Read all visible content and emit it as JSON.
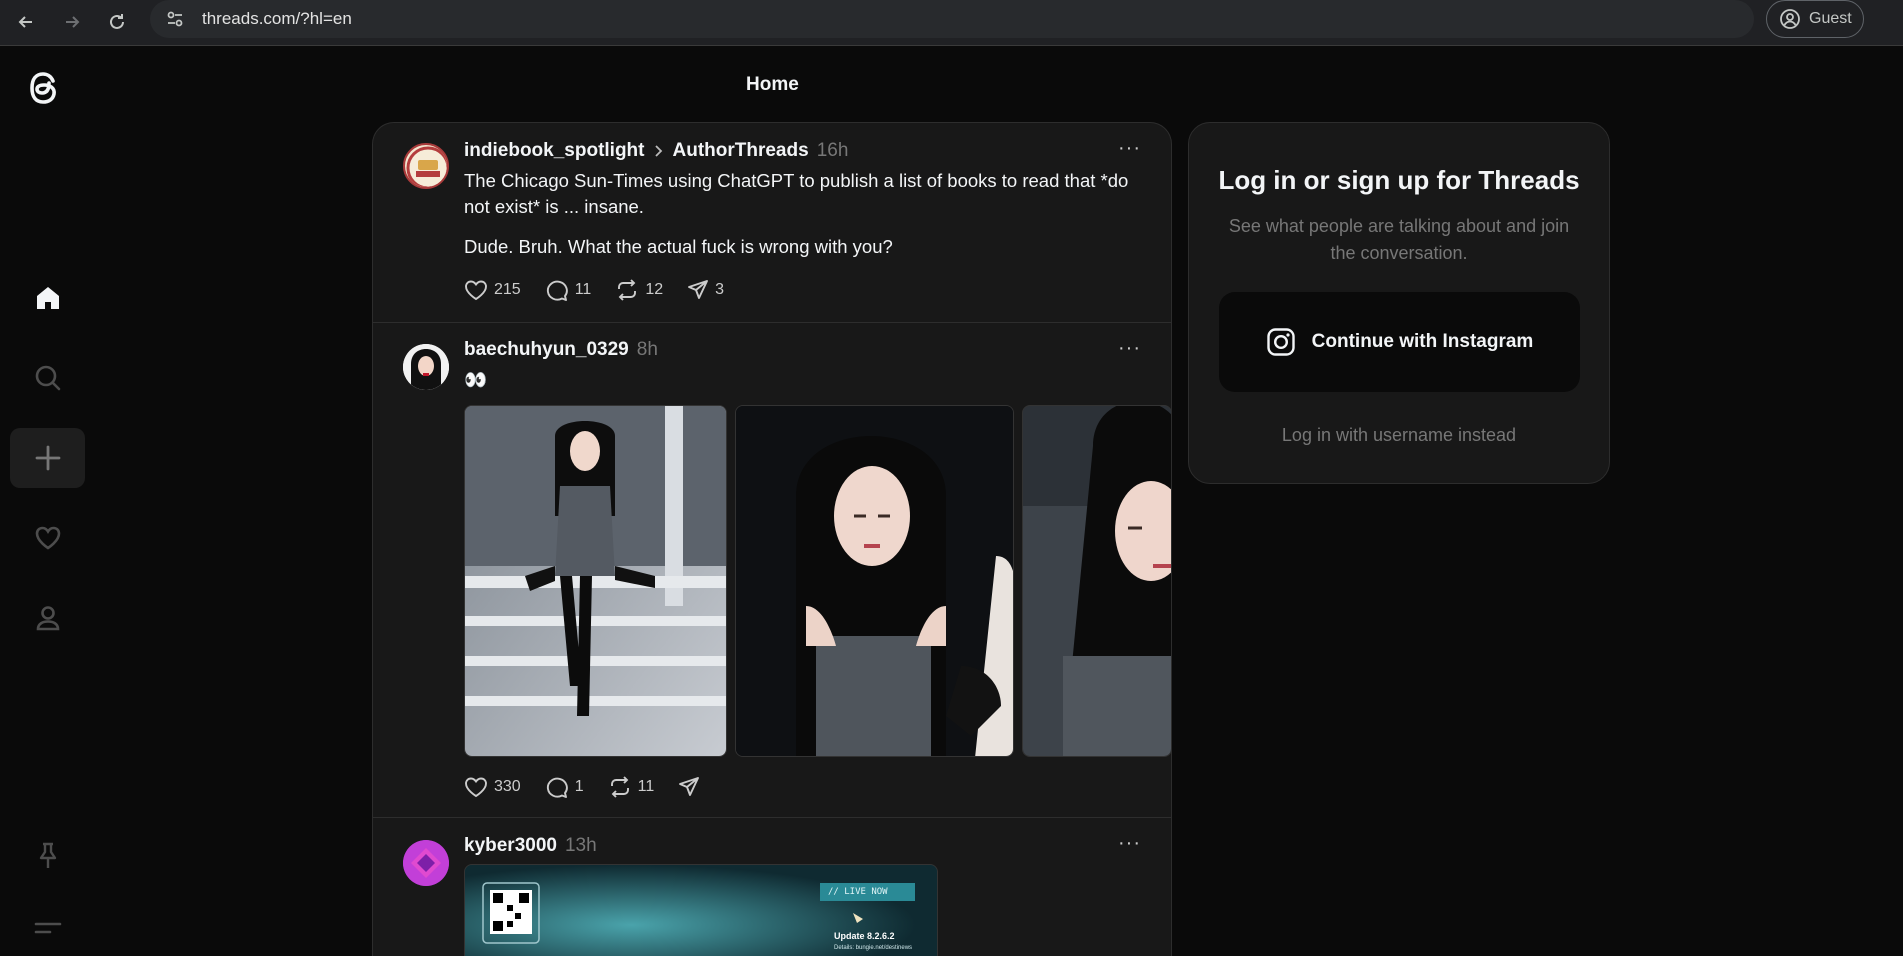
{
  "browser": {
    "url": "threads.com/?hl=en",
    "profile_label": "Guest"
  },
  "header": {
    "title": "Home"
  },
  "sidebar": {
    "items": [
      {
        "name": "home",
        "icon": "home-icon"
      },
      {
        "name": "search",
        "icon": "search-icon"
      },
      {
        "name": "create",
        "icon": "plus-icon"
      },
      {
        "name": "activity",
        "icon": "heart-icon"
      },
      {
        "name": "profile",
        "icon": "user-icon"
      },
      {
        "name": "pin",
        "icon": "pin-icon"
      },
      {
        "name": "menu",
        "icon": "menu-icon"
      }
    ]
  },
  "posts": [
    {
      "username": "indiebook_spotlight",
      "community": "AuthorThreads",
      "time": "16h",
      "text1": "The Chicago Sun-Times using ChatGPT to publish a list of books to read that *do not exist* is ... insane.",
      "text2": "Dude. Bruh. What the actual fuck is wrong with you?",
      "likes": "215",
      "replies": "11",
      "reposts": "12",
      "shares": "3"
    },
    {
      "username": "baechuhyun_0329",
      "time": "8h",
      "text1": "👀",
      "likes": "330",
      "replies": "1",
      "reposts": "11",
      "shares": ""
    },
    {
      "username": "kyber3000",
      "time": "13h",
      "media_text1": "// LIVE NOW",
      "media_text2": "Update 8.2.6.2",
      "media_text3": "Details: bungie.net/destinews"
    }
  ],
  "login": {
    "title": "Log in or sign up for Threads",
    "subtitle": "See what people are talking about and join the conversation.",
    "instagram_button": "Continue with Instagram",
    "alt_link": "Log in with username instead"
  },
  "colors": {
    "background": "#0a0a0a",
    "card": "#181818",
    "muted": "#777777",
    "text": "#f3f5f7"
  }
}
